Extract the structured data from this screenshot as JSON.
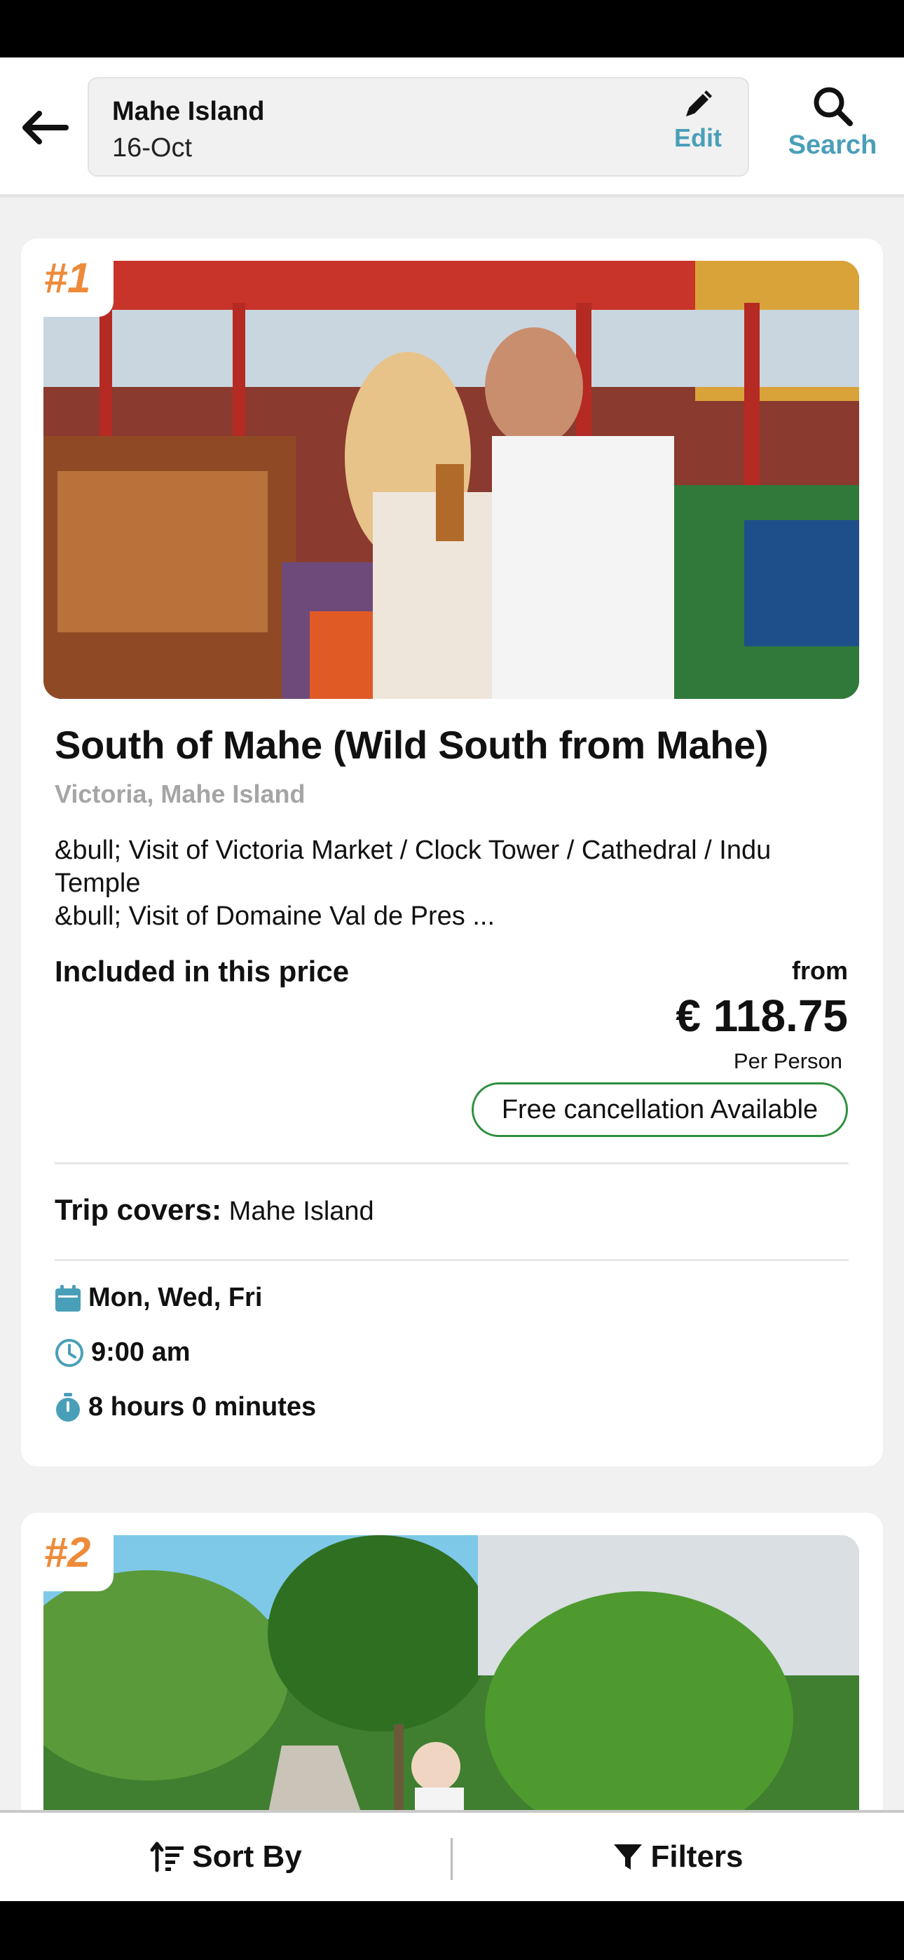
{
  "header": {
    "destination": "Mahe Island",
    "date": "16-Oct",
    "edit_label": "Edit",
    "search_label": "Search",
    "accent_color": "#4a9fb8"
  },
  "results": [
    {
      "rank": "#1",
      "title": "South of Mahe (Wild South from Mahe)",
      "location": "Victoria, Mahe Island",
      "description_line1": "&bull; Visit of Victoria Market / Clock Tower / Cathedral / Indu Temple",
      "description_line2": "&bull; Visit of Domaine Val de Pres ...",
      "included_label": "Included in this price",
      "price_prefix": "from",
      "price": "€ 118.75",
      "price_unit": "Per Person",
      "cancellation": "Free cancellation Available",
      "trip_covers_label": "Trip covers:",
      "trip_covers_value": "Mahe Island",
      "days": "Mon, Wed, Fri",
      "time": "9:00 am",
      "duration": "8 hours 0 minutes",
      "image_icon": "market-photo"
    },
    {
      "rank": "#2",
      "image_icon": "tropical-road-photo"
    }
  ],
  "bottom_bar": {
    "sort_label": "Sort By",
    "filter_label": "Filters"
  },
  "colors": {
    "rank": "#ed8b3a",
    "cancellation_border": "#2f8f3f",
    "icon": "#4a9fb8"
  }
}
